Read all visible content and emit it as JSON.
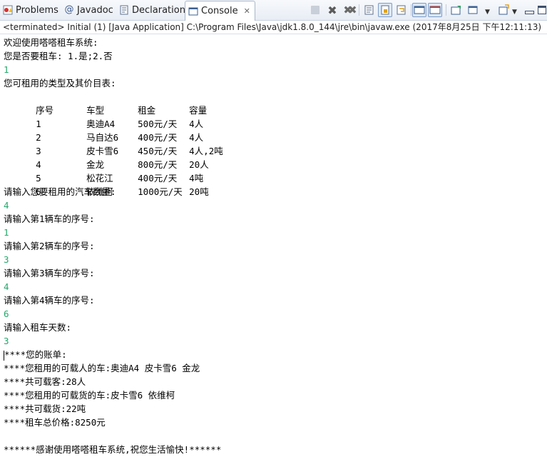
{
  "tabs": [
    {
      "label": "Problems",
      "icon": "problems-icon"
    },
    {
      "label": "Javadoc",
      "icon": "javadoc-icon"
    },
    {
      "label": "Declaration",
      "icon": "declaration-icon"
    },
    {
      "label": "Console",
      "icon": "console-icon",
      "active": true
    }
  ],
  "toolbar": {
    "icons": [
      "terminate-icon",
      "remove-launch-icon",
      "remove-all-terminated-icon",
      "clear-console-icon",
      "scroll-lock-icon",
      "word-wrap-icon",
      "show-on-stdout-icon",
      "show-on-stderr-icon",
      "pin-console-icon",
      "display-selected-console-icon",
      "open-console-icon",
      "minimize-icon",
      "maximize-icon"
    ]
  },
  "status_line": "<terminated> Initial (1) [Java Application] C:\\Program Files\\Java\\jdk1.8.0_144\\jre\\bin\\javaw.exe (2017年8月25日 下午12:11:13)",
  "console": {
    "welcome": "欢迎使用嗒嗒租车系统:",
    "ask_rent": "您是否要租车: 1.是;2.否",
    "input_rent": "1",
    "price_title": "您可租用的类型及其价目表:",
    "table_header": [
      "序号",
      "车型",
      "租金",
      "容量"
    ],
    "table_rows": [
      [
        "1",
        "奥迪A4",
        "500元/天",
        "4人"
      ],
      [
        "2",
        "马自达6",
        "400元/天",
        "4人"
      ],
      [
        "3",
        "皮卡雪6",
        "450元/天",
        "4人,2吨"
      ],
      [
        "4",
        "金龙",
        "800元/天",
        "20人"
      ],
      [
        "5",
        "松花江",
        "400元/天",
        "4吨"
      ],
      [
        "6",
        "依维柯",
        "1000元/天",
        "20吨"
      ]
    ],
    "ask_count": "请输入您要租用的汽车数量:",
    "input_count": "4",
    "ask_car1": "请输入第1辆车的序号:",
    "input_car1": "1",
    "ask_car2": "请输入第2辆车的序号:",
    "input_car2": "3",
    "ask_car3": "请输入第3辆车的序号:",
    "input_car3": "4",
    "ask_car4": "请输入第4辆车的序号:",
    "input_car4": "6",
    "ask_days": "请输入租车天数:",
    "input_days": "3",
    "bill_title": "****您的账单:",
    "passenger_cars": "****您租用的可载人的车:奥迪A4 皮卡雪6 金龙",
    "passenger_total": "****共可载客:28人",
    "cargo_cars": "****您租用的可载货的车:皮卡雪6 依维柯",
    "cargo_total": "****共可载货:22吨",
    "total_price": "****租车总价格:8250元",
    "thanks": "******感谢使用嗒嗒租车系统,祝您生活愉快!******"
  }
}
